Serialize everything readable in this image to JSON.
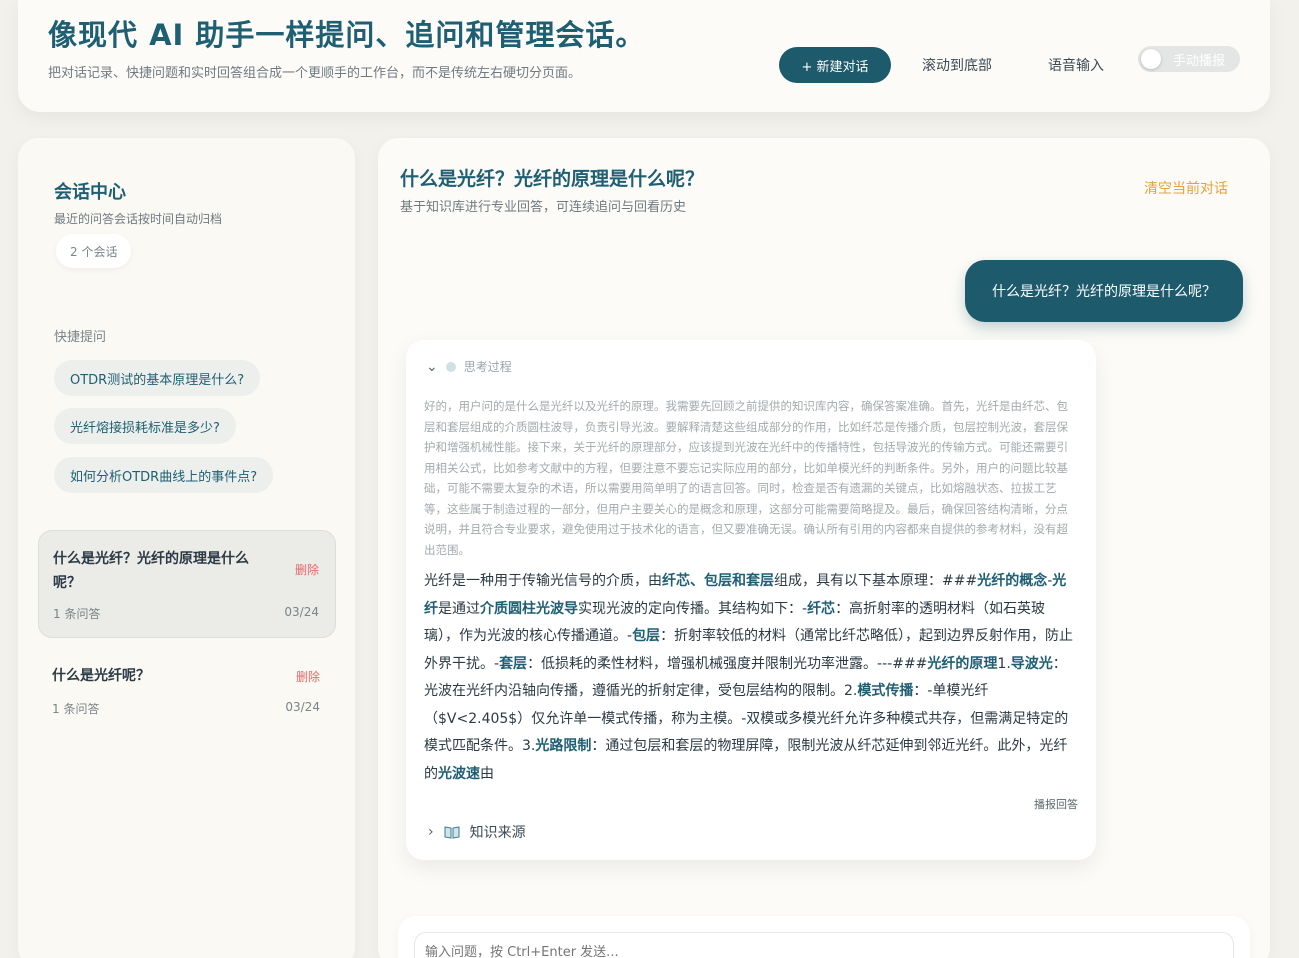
{
  "header": {
    "title": "像现代 AI 助手一样提问、追问和管理会话。",
    "subtitle": "把对话记录、快捷问题和实时回答组合成一个更顺手的工作台，而不是传统左右硬切分页面。",
    "new_chat_label": "+ 新建对话",
    "scroll_bottom_label": "滚动到底部",
    "voice_input_label": "语音输入",
    "manual_play_label": "手动播报"
  },
  "sidebar": {
    "title": "会话中心",
    "desc": "最近的问答会话按时间自动归档",
    "count": "2 个会话",
    "quick_title": "快捷提问",
    "quick_questions": [
      "OTDR测试的基本原理是什么?",
      "光纤熔接损耗标准是多少?",
      "如何分析OTDR曲线上的事件点?"
    ],
    "conversations": [
      {
        "title": "什么是光纤？光纤的原理是什么呢？",
        "delete": "删除",
        "meta": "1 条问答",
        "date": "03/24"
      },
      {
        "title": "什么是光纤呢？",
        "delete": "删除",
        "meta": "1 条问答",
        "date": "03/24"
      }
    ]
  },
  "main": {
    "title": "什么是光纤？光纤的原理是什么呢？",
    "subtitle": "基于知识库进行专业回答，可连续追问与回看历史",
    "clear_label": "清空当前对话",
    "user_message": "什么是光纤？光纤的原理是什么呢？",
    "think_label": "思考过程",
    "think_text": "好的，用户问的是什么是光纤以及光纤的原理。我需要先回顾之前提供的知识库内容，确保答案准确。首先，光纤是由纤芯、包层和套层组成的介质圆柱波导，负责引导光波。要解释清楚这些组成部分的作用，比如纤芯是传播介质，包层控制光波，套层保护和增强机械性能。接下来，关于光纤的原理部分，应该提到光波在光纤中的传播特性，包括导波光的传输方式。可能还需要引用相关公式，比如参考文献中的方程，但要注意不要忘记实际应用的部分，比如单模光纤的判断条件。另外，用户的问题比较基础，可能不需要太复杂的术语，所以需要用简单明了的语言回答。同时，检查是否有遗漏的关键点，比如熔融状态、拉拔工艺等，这些属于制造过程的一部分，但用户主要关心的是概念和原理，这部分可能需要简略提及。最后，确保回答结构清晰，分点说明，并且符合专业要求，避免使用过于技术化的语言，但又要准确无误。确认所有引用的内容都来自提供的参考材料，没有超出范围。",
    "answer_segments": [
      {
        "t": "光纤是一种用于传输光信号的介质，由",
        "b": false
      },
      {
        "t": "纤芯、包层和套层",
        "b": true
      },
      {
        "t": "组成，具有以下基本原理：###",
        "b": false
      },
      {
        "t": "光纤的概念",
        "b": true
      },
      {
        "t": "-",
        "b": false
      },
      {
        "t": "光纤",
        "b": true
      },
      {
        "t": "是通过",
        "b": false
      },
      {
        "t": "介质圆柱光波导",
        "b": true
      },
      {
        "t": "实现光波的定向传播。其结构如下：-",
        "b": false
      },
      {
        "t": "纤芯",
        "b": true
      },
      {
        "t": "：高折射率的透明材料（如石英玻璃），作为光波的核心传播通道。-",
        "b": false
      },
      {
        "t": "包层",
        "b": true
      },
      {
        "t": "：折射率较低的材料（通常比纤芯略低），起到边界反射作用，防止外界干扰。-",
        "b": false
      },
      {
        "t": "套层",
        "b": true
      },
      {
        "t": "：低损耗的柔性材料，增强机械强度并限制光功率泄露。---###",
        "b": false
      },
      {
        "t": "光纤的原理",
        "b": true
      },
      {
        "t": "1.",
        "b": false
      },
      {
        "t": "导波光",
        "b": true
      },
      {
        "t": "：光波在光纤内沿轴向传播，遵循光的折射定律，受包层结构的限制。2.",
        "b": false
      },
      {
        "t": "模式传播",
        "b": true
      },
      {
        "t": "：-单模光纤（$V<2.405$）仅允许单一模式传播，称为主模。-双模或多模光纤允许多种模式共存，但需满足特定的模式匹配条件。3.",
        "b": false
      },
      {
        "t": "光路限制",
        "b": true
      },
      {
        "t": "：通过包层和套层的物理屏障，限制光波从纤芯延伸到邻近光纤。此外，光纤的",
        "b": false
      },
      {
        "t": "光波速",
        "b": true
      },
      {
        "t": "由",
        "b": false
      }
    ],
    "play_answer_label": "播报回答",
    "sources_label": "知识来源",
    "input_placeholder": "输入问题，按 Ctrl+Enter 发送..."
  },
  "icons": {
    "think_toggle": "chevron-down-icon",
    "sources_toggle": "chevron-right-icon",
    "book": "book-icon"
  },
  "colors": {
    "primary": "#1c5a6c",
    "title": "#1f5f73",
    "warning": "#e6a23c",
    "danger": "#e06a6a"
  }
}
